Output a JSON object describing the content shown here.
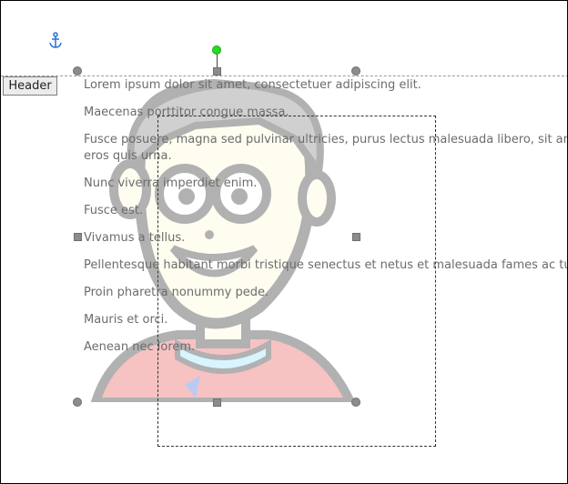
{
  "header": {
    "label": "Header"
  },
  "icons": {
    "anchor": "anchor-icon",
    "rotate": "rotate-handle"
  },
  "colors": {
    "rotate_handle": "#22dd22",
    "selection_handle": "#8c8c8c",
    "anchor": "#2b6fd6",
    "text": "#6c6c6c"
  },
  "paragraphs": [
    "Lorem ipsum dolor sit amet, consectetuer adipiscing elit.",
    "Maecenas porttitor congue massa.",
    "Fusce posuere, magna sed pulvinar ultricies, purus lectus malesuada libero, sit amet commodo magna",
    "eros quis urna.",
    "Nunc viverra imperdiet enim.",
    "Fusce est.",
    "Vivamus a tellus.",
    "Pellentesque habitant morbi tristique senectus et netus et malesuada fames ac turpis egestas.",
    "Proin pharetra nonummy pede.",
    "Mauris et orci.",
    "Aenean nec lorem."
  ]
}
